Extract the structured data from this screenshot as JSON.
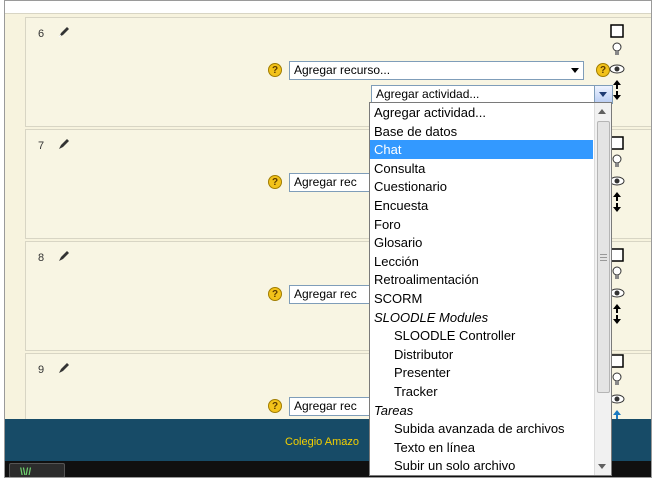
{
  "sections": [
    {
      "number": "6",
      "add_resource": "Agregar recurso...",
      "add_activity": "Agregar actividad..."
    },
    {
      "number": "7",
      "add_resource": "Agregar rec"
    },
    {
      "number": "8",
      "add_resource": "Agregar rec"
    },
    {
      "number": "9",
      "add_resource": "Agregar rec"
    }
  ],
  "help_glyph": "?",
  "footer_text": "Colegio Amazo",
  "dropdown": {
    "selected": "Chat",
    "options": [
      {
        "label": "Agregar actividad...",
        "kind": "option"
      },
      {
        "label": "Base de datos",
        "kind": "option"
      },
      {
        "label": "Chat",
        "kind": "option"
      },
      {
        "label": "Consulta",
        "kind": "option"
      },
      {
        "label": "Cuestionario",
        "kind": "option"
      },
      {
        "label": "Encuesta",
        "kind": "option"
      },
      {
        "label": "Foro",
        "kind": "option"
      },
      {
        "label": "Glosario",
        "kind": "option"
      },
      {
        "label": "Lección",
        "kind": "option"
      },
      {
        "label": "Retroalimentación",
        "kind": "option"
      },
      {
        "label": "SCORM",
        "kind": "option"
      },
      {
        "label": "SLOODLE Modules",
        "kind": "group"
      },
      {
        "label": "SLOODLE Controller",
        "kind": "sub"
      },
      {
        "label": "Distributor",
        "kind": "sub"
      },
      {
        "label": "Presenter",
        "kind": "sub"
      },
      {
        "label": "Tracker",
        "kind": "sub"
      },
      {
        "label": "Tareas",
        "kind": "group"
      },
      {
        "label": "Subida avanzada de archivos",
        "kind": "sub"
      },
      {
        "label": "Texto en línea",
        "kind": "sub"
      },
      {
        "label": "Subir un solo archivo",
        "kind": "sub"
      }
    ]
  },
  "icons": {
    "edit": "pencil-icon",
    "help": "help-icon",
    "highlight": "lightbulb-icon",
    "visibility": "eye-icon",
    "move": "move-arrows-icon",
    "select_box": "checkbox-icon",
    "taskbar": "app-icon"
  },
  "taskbar_label": "\\\\//",
  "colors": {
    "page_bg": "#f7f3de",
    "footer_bg": "#174b67",
    "footer_text": "#f4d000",
    "selection": "#3399ff"
  }
}
